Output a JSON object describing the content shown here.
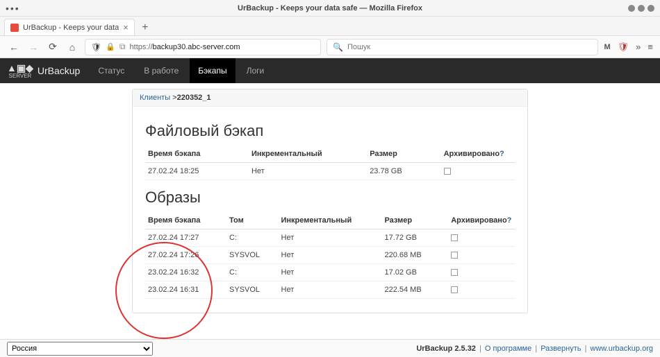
{
  "window": {
    "title": "UrBackup - Keeps your data safe — Mozilla Firefox"
  },
  "tab": {
    "title": "UrBackup - Keeps your data"
  },
  "url": {
    "scheme": "https://",
    "host": "backup30.abc-server.com"
  },
  "search": {
    "placeholder": "Пошук"
  },
  "appnav": {
    "brand": "UrBackup",
    "sub": "SERVER",
    "items": [
      "Статус",
      "В работе",
      "Бэкапы",
      "Логи"
    ],
    "active_index": 2
  },
  "breadcrumb": {
    "root": "Клиенты",
    "sep": " >",
    "client": "220352_1"
  },
  "section_file": {
    "title": "Файловый бэкап",
    "headers": {
      "time": "Время бэкапа",
      "incr": "Инкрементальный",
      "size": "Размер",
      "arch": "Архивировано"
    },
    "rows": [
      {
        "time": "27.02.24 18:25",
        "incr": "Нет",
        "size": "23.78 GB",
        "arch": false
      }
    ]
  },
  "section_img": {
    "title": "Образы",
    "headers": {
      "time": "Время бэкапа",
      "vol": "Том",
      "incr": "Инкрементальный",
      "size": "Размер",
      "arch": "Архивировано"
    },
    "rows": [
      {
        "time": "27.02.24 17:27",
        "vol": "C:",
        "incr": "Нет",
        "size": "17.72 GB",
        "arch": false
      },
      {
        "time": "27.02.24 17:26",
        "vol": "SYSVOL",
        "incr": "Нет",
        "size": "220.68 MB",
        "arch": false
      },
      {
        "time": "23.02.24 16:32",
        "vol": "C:",
        "incr": "Нет",
        "size": "17.02 GB",
        "arch": false
      },
      {
        "time": "23.02.24 16:31",
        "vol": "SYSVOL",
        "incr": "Нет",
        "size": "222.54 MB",
        "arch": false
      }
    ]
  },
  "footer": {
    "locale": "Россия",
    "version": "UrBackup 2.5.32",
    "link_about": "О программе",
    "link_deploy": "Развернуть",
    "link_site": "www.urbackup.org",
    "sep": " | "
  }
}
